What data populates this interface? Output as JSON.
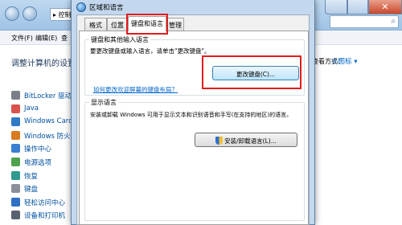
{
  "background": {
    "address_text": "▸ 控制",
    "menu": [
      "文件(F)",
      "编辑(E)",
      "查"
    ],
    "heading": "调整计算机的设置",
    "view_label": "查看方式：",
    "view_value": "小图标 ▾",
    "side_hint": "表",
    "items": [
      {
        "label": "BitLocker 驱动器",
        "color": "#7a7f88"
      },
      {
        "label": "Java",
        "color": "#d9534f"
      },
      {
        "label": "Windows CardSp",
        "color": "#2f79c6"
      },
      {
        "label": "Windows 防火墙",
        "color": "#d97b1f"
      },
      {
        "label": "操作中心",
        "color": "#3a7fd0"
      },
      {
        "label": "电源选项",
        "color": "#4da34d"
      },
      {
        "label": "恢复",
        "color": "#2f9a8f"
      },
      {
        "label": "键盘",
        "color": "#8a8f99"
      },
      {
        "label": "轻松访问中心",
        "color": "#2f6fc6"
      },
      {
        "label": "设备和打印机",
        "color": "#5a6170"
      }
    ]
  },
  "dialog": {
    "title": "区域和语言",
    "tabs": [
      "格式",
      "位置",
      "键盘和语言",
      "管理"
    ],
    "active_tab": "键盘和语言",
    "keyboard_group": {
      "legend": "键盘和其他输入语言",
      "description": "要更改键盘或输入语言，请单击\"更改键盘\"。",
      "button": "更改键盘(C)...",
      "link": "如何更改欢迎屏幕的键盘布局？"
    },
    "display_group": {
      "legend": "显示语言",
      "description": "安装或卸载 Windows 可用于显示文本和识别语音和手写(在支持的地区)的语言。",
      "button": "安装/卸载语言(L)..."
    }
  },
  "colors": {
    "highlight_red": "#e21b1b",
    "link_blue": "#0066cc",
    "dialog_frame": "#c3d8ee"
  }
}
